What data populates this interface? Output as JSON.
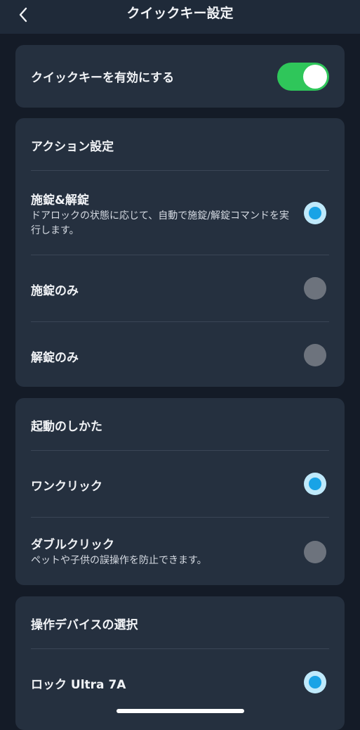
{
  "header": {
    "title": "クイックキー設定"
  },
  "enable_card": {
    "label": "クイックキーを有効にする",
    "toggle_on": true
  },
  "action_card": {
    "title": "アクション設定",
    "options": [
      {
        "label": "施錠&解錠",
        "desc": "ドアロックの状態に応じて、自動で施錠/解錠コマンドを実行します。",
        "selected": true
      },
      {
        "label": "施錠のみ",
        "selected": false
      },
      {
        "label": "解錠のみ",
        "selected": false
      }
    ]
  },
  "activation_card": {
    "title": "起動のしかた",
    "options": [
      {
        "label": "ワンクリック",
        "selected": true
      },
      {
        "label": "ダブルクリック",
        "desc": "ペットや子供の誤操作を防止できます。",
        "selected": false
      }
    ]
  },
  "device_card": {
    "title": "操作デバイスの選択",
    "options": [
      {
        "label": "ロック Ultra 7A",
        "selected": true
      }
    ]
  },
  "colors": {
    "background": "#141b27",
    "card": "#25303f",
    "toggle_on": "#2fc65a",
    "radio_selected": "#19a3e6",
    "radio_unselected": "#6d737d"
  }
}
